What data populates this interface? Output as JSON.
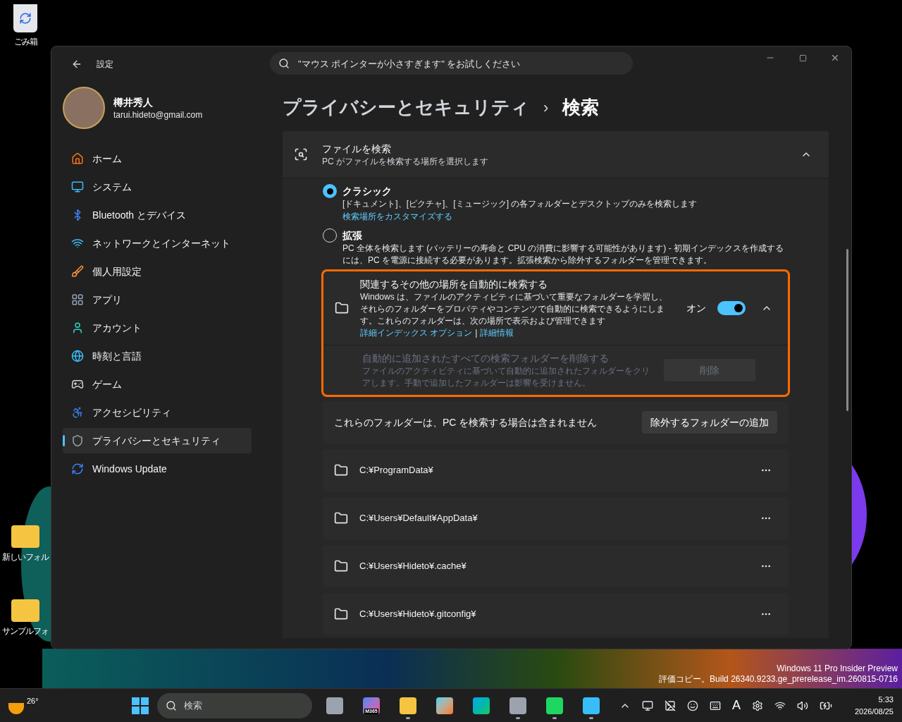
{
  "desktop": {
    "icons": [
      {
        "label": "ごみ箱"
      },
      {
        "label": "新しいフォル"
      },
      {
        "label": "サンプルフォ"
      }
    ],
    "build_info": [
      "Windows 11 Pro Insider Preview",
      "評価コピー。Build 26340.9233.ge_prerelease_im.260815-0716"
    ]
  },
  "window": {
    "title": "設定",
    "search": {
      "placeholder": "\"マウス ポインターが小さすぎます\" をお試しください"
    }
  },
  "user": {
    "name": "樽井秀人",
    "email": "tarui.hideto@gmail.com"
  },
  "sidebar": {
    "items": [
      {
        "label": "ホーム",
        "selected": false
      },
      {
        "label": "システム",
        "selected": false
      },
      {
        "label": "Bluetooth とデバイス",
        "selected": false
      },
      {
        "label": "ネットワークとインターネット",
        "selected": false
      },
      {
        "label": "個人用設定",
        "selected": false
      },
      {
        "label": "アプリ",
        "selected": false
      },
      {
        "label": "アカウント",
        "selected": false
      },
      {
        "label": "時刻と言語",
        "selected": false
      },
      {
        "label": "ゲーム",
        "selected": false
      },
      {
        "label": "アクセシビリティ",
        "selected": false
      },
      {
        "label": "プライバシーとセキュリティ",
        "selected": true
      },
      {
        "label": "Windows Update",
        "selected": false
      }
    ]
  },
  "breadcrumb": {
    "parent": "プライバシーとセキュリティ",
    "separator": "›",
    "current": "検索"
  },
  "find_files": {
    "title": "ファイルを検索",
    "subtitle": "PC がファイルを検索する場所を選択します",
    "expanded": true,
    "options": [
      {
        "label": "クラシック",
        "description": "[ドキュメント]、[ピクチャ]、[ミュージック] の各フォルダーとデスクトップのみを検索します",
        "link": "検索場所をカスタマイズする",
        "selected": true
      },
      {
        "label": "拡張",
        "description": "PC 全体を検索します (バッテリーの寿命と CPU の消費に影響する可能性があります) - 初期インデックスを作成するには、PC を電源に接続する必要があります。拡張検索から除外するフォルダーを管理できます。",
        "selected": false
      }
    ]
  },
  "auto_search": {
    "highlighted": true,
    "title": "関連するその他の場所を自動的に検索する",
    "description": "Windows は、ファイルのアクティビティに基づいて重要なフォルダーを学習し、それらのフォルダーをプロパティやコンテンツで自動的に検索できるようにします。これらのフォルダーは、次の場所で表示および管理できます",
    "links": [
      "詳細インデックス オプション",
      "詳細情報"
    ],
    "link_separator": "|",
    "state_label": "オン",
    "on": true,
    "expanded": true,
    "clear": {
      "title": "自動的に追加されたすべての検索フォルダーを削除する",
      "description": "ファイルのアクティビティに基づいて自動的に追加されたフォルダーをクリアします。手動で追加したフォルダーは影響を受けません。",
      "button": "削除",
      "disabled": true
    }
  },
  "exclusions": {
    "title": "これらのフォルダーは、PC を検索する場合は含まれません",
    "button": "除外するフォルダーの追加",
    "folders": [
      "C:¥ProgramData¥",
      "C:¥Users¥Default¥AppData¥",
      "C:¥Users¥Hideto¥.cache¥",
      "C:¥Users¥Hideto¥.gitconfig¥"
    ]
  },
  "taskbar": {
    "weather": "26°",
    "search": {
      "placeholder": "検索"
    },
    "apps": [
      {
        "running": false
      },
      {
        "running": false,
        "badge": "M365"
      },
      {
        "running": true
      },
      {
        "running": false
      },
      {
        "running": false
      },
      {
        "running": true
      },
      {
        "running": true
      },
      {
        "running": true
      }
    ],
    "ime": "A",
    "time": "5:33",
    "date": "2026/08/25"
  }
}
